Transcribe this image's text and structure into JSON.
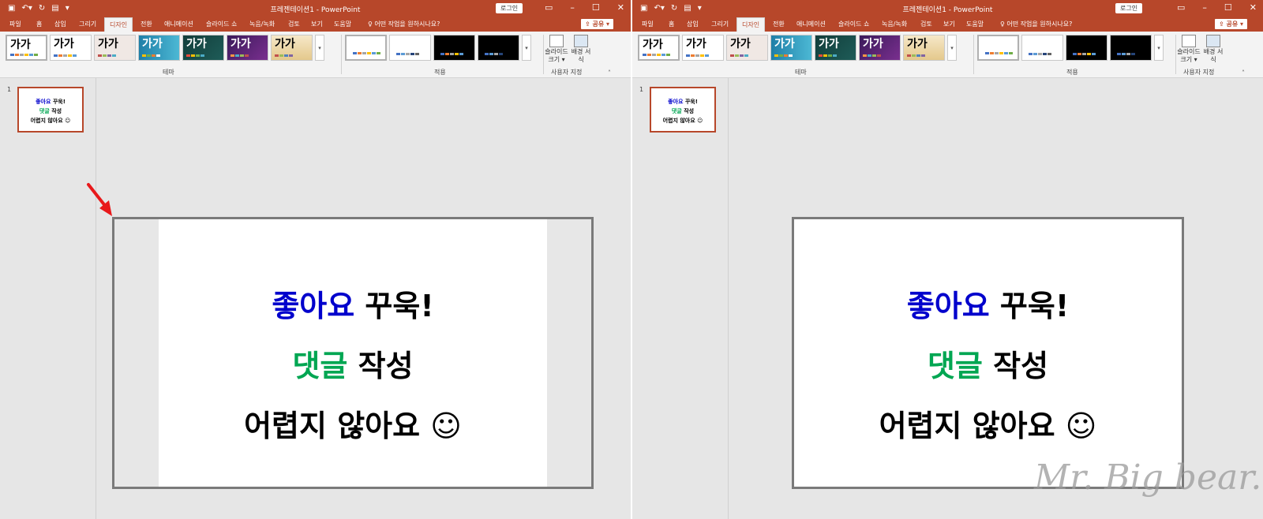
{
  "app": {
    "doc_title": "프레젠테이션1 - PowerPoint",
    "login_label": "로그인",
    "share_label": "공유",
    "tell_me": "어떤 작업을 원하시나요?"
  },
  "tabs": [
    "파일",
    "홈",
    "삽입",
    "그리기",
    "디자인",
    "전환",
    "애니메이션",
    "슬라이드 쇼",
    "녹음/녹화",
    "검토",
    "보기",
    "도움말"
  ],
  "ribbon": {
    "theme_group_label": "테마",
    "variants_group_label": "적용",
    "customize_group_label": "사용자 지정",
    "theme_thumb_label": "가가",
    "slide_size_label": "슬라이드 크기",
    "format_background_label": "배경 서식"
  },
  "slide_panel": {
    "slide_number": "1"
  },
  "slide": {
    "line1_a": "좋아요",
    "line1_b": " 꾸욱!",
    "line2_a": "댓글",
    "line2_b": " 작성",
    "line3": "어렵지 않아요 ☺"
  },
  "colors": {
    "accent": "#b7472a",
    "text_blue": "#0000cc",
    "text_green": "#00a652"
  },
  "watermark": "Mr. Big bear."
}
